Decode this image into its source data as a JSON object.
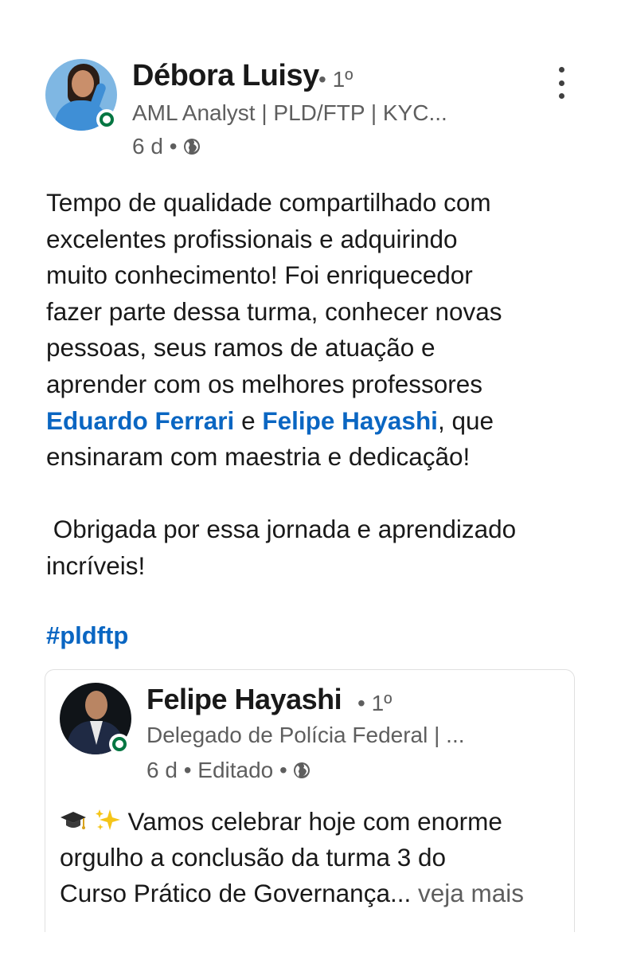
{
  "post": {
    "author": {
      "name": "Débora Luisy",
      "degree": "• 1º",
      "headline": "AML Analyst | PLD/FTP | KYC...",
      "time": "6 d •"
    },
    "body": {
      "line1": "Tempo de qualidade compartilhado com",
      "line2": "excelentes profissionais e adquirindo",
      "line3": "muito conhecimento! Foi enriquecedor",
      "line4": "fazer parte dessa turma, conhecer novas",
      "line5": "pessoas, seus ramos de atuação e",
      "line6": "aprender com os melhores professores",
      "mention1": "Eduardo Ferrari",
      "connector": " e ",
      "mention2": "Felipe Hayashi",
      "after_mentions": ", que",
      "line8": "ensinaram com maestria e dedicação!",
      "line9": " Obrigada por essa jornada e aprendizado",
      "line10": "incríveis!"
    },
    "hashtag": "#pldftp"
  },
  "shared_post": {
    "author": {
      "name": "Felipe Hayashi",
      "degree": "• 1º",
      "headline": "Delegado de Polícia Federal | ...",
      "time": "6 d • Editado •"
    },
    "text": {
      "line1": " Vamos celebrar hoje com enorme",
      "line2": "orgulho a conclusão da turma 3 do",
      "line3": "Curso Prático de Governança",
      "ellipsis": "...",
      "see_more": " veja mais"
    }
  },
  "icons": {
    "globe": "globe-icon",
    "menu": "more-vertical-icon",
    "graduation": "graduation-cap-icon",
    "sparkles": "sparkles-icon"
  },
  "colors": {
    "link": "#0a66c2",
    "online": "#057642",
    "secondary_text": "#5e5e5e"
  }
}
